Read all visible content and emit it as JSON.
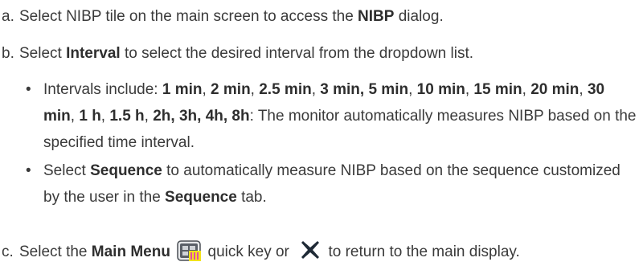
{
  "steps": {
    "a": {
      "marker": "a.",
      "t1": "Select NIBP tile on the main screen to access the ",
      "b1": "NIBP",
      "t2": " dialog."
    },
    "b": {
      "marker": "b.",
      "t1": "Select ",
      "b1": "Interval",
      "t2": " to select the desired interval from the dropdown list."
    },
    "b_bullet_1": {
      "bullet": "•",
      "t0": "Intervals include: ",
      "i1": "1 min",
      "c1": ", ",
      "i2": "2 min",
      "c2": ", ",
      "i3": "2.5 min",
      "c3": ", ",
      "i4": "3 min, 5 min",
      "c4": ", ",
      "i5": "10 min",
      "c5": ", ",
      "i6": "15 min",
      "c6": ", ",
      "i7": "20 min",
      "c7": ", ",
      "i8": "30 min",
      "c8": ", ",
      "i9": "1 h",
      "c9": ", ",
      "i10": "1.5 h",
      "c10": ",  ",
      "i11": "2h, 3h, 4h, 8h",
      "t_end": ": The monitor automatically measures NIBP based on the specified time interval."
    },
    "b_bullet_2": {
      "bullet": "•",
      "t1": "Select ",
      "b1": "Sequence",
      "t2": " to automatically measure NIBP based on the sequence customized by the user in the ",
      "b2": "Sequence",
      "t3": " tab."
    },
    "c": {
      "marker": "c.",
      "t1": "Select the ",
      "b1": "Main Menu",
      "t2": " quick key or ",
      "t3": " to return to the main display."
    }
  },
  "icons": {
    "main_menu": "main-menu-icon",
    "close": "close-x-icon"
  },
  "colors": {
    "text": "#3a3a3a",
    "close_icon": "#1f2a36",
    "menu_icon_frame": "#4a4f55",
    "menu_icon_highlight": "#f2e21c"
  }
}
